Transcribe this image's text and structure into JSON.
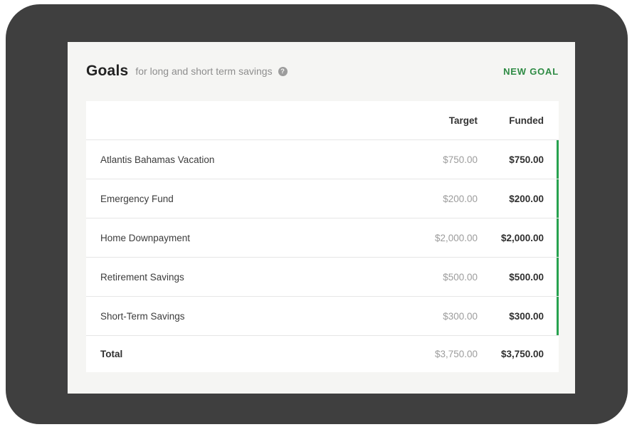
{
  "frame": {
    "device_color": "#3f3f3f",
    "page_background": "#ffffff",
    "card_background": "#f5f5f3"
  },
  "header": {
    "title": "Goals",
    "subtitle": "for long and short term savings",
    "help_glyph": "?",
    "new_goal_label": "NEW GOAL",
    "accent_color": "#2e8b44"
  },
  "table": {
    "columns": {
      "target": "Target",
      "funded": "Funded"
    },
    "rows": [
      {
        "name": "Atlantis Bahamas Vacation",
        "target": "$750.00",
        "funded": "$750.00",
        "fully_funded": true
      },
      {
        "name": "Emergency Fund",
        "target": "$200.00",
        "funded": "$200.00",
        "fully_funded": true
      },
      {
        "name": "Home Downpayment",
        "target": "$2,000.00",
        "funded": "$2,000.00",
        "fully_funded": true
      },
      {
        "name": "Retirement Savings",
        "target": "$500.00",
        "funded": "$500.00",
        "fully_funded": true
      },
      {
        "name": "Short-Term Savings",
        "target": "$300.00",
        "funded": "$300.00",
        "fully_funded": true
      }
    ],
    "total": {
      "name": "Total",
      "target": "$3,750.00",
      "funded": "$3,750.00"
    },
    "progress_bar_color": "#27a24f"
  }
}
